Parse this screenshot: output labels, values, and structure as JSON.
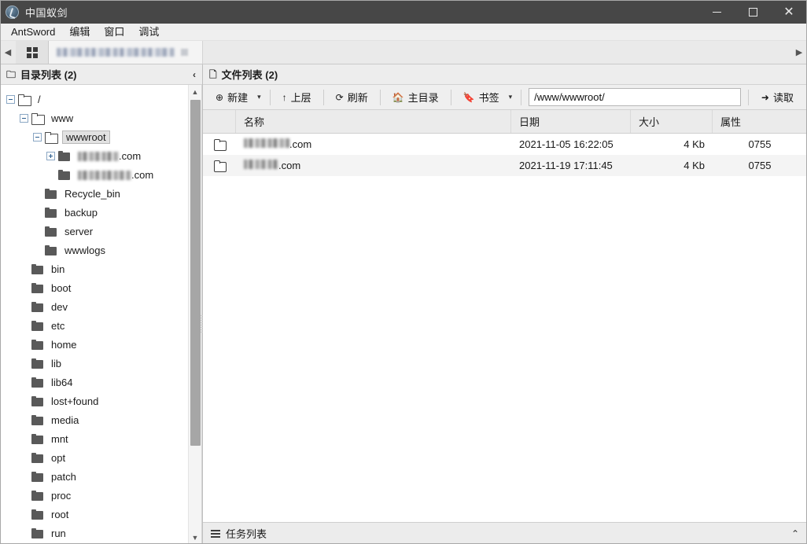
{
  "window": {
    "title": "中国蚁剑",
    "app_icon": "antsword-logo-icon",
    "minimize": "minimize-icon",
    "maximize": "maximize-icon",
    "close": "close-icon"
  },
  "menubar": {
    "items": [
      {
        "label": "AntSword"
      },
      {
        "label": "编辑"
      },
      {
        "label": "窗口"
      },
      {
        "label": "调试"
      }
    ]
  },
  "tabstrip": {
    "prev_arrow": "◀",
    "next_arrow": "▶",
    "grid_button": "grid-icon",
    "tab_label_redacted": ""
  },
  "left_panel": {
    "header": {
      "icon": "folder-outline-icon",
      "title": "目录列表 (2)",
      "collapse": "‹"
    },
    "tree": [
      {
        "label": "/",
        "depth": 0,
        "expander": "minus",
        "folder": "open",
        "selected": false,
        "blurred": false
      },
      {
        "label": "www",
        "depth": 1,
        "expander": "minus",
        "folder": "open",
        "selected": false,
        "blurred": false
      },
      {
        "label": "wwwroot",
        "depth": 2,
        "expander": "minus",
        "folder": "open",
        "selected": true,
        "blurred": false
      },
      {
        "label": ".com",
        "depth": 3,
        "expander": "plus",
        "folder": "closed",
        "selected": false,
        "blurred": true,
        "blur_width": 52
      },
      {
        "label": ".com",
        "depth": 3,
        "expander": "none",
        "folder": "closed",
        "selected": false,
        "blurred": true,
        "blur_width": 68
      },
      {
        "label": "Recycle_bin",
        "depth": 2,
        "expander": "none",
        "folder": "closed",
        "selected": false,
        "blurred": false
      },
      {
        "label": "backup",
        "depth": 2,
        "expander": "none",
        "folder": "closed",
        "selected": false,
        "blurred": false
      },
      {
        "label": "server",
        "depth": 2,
        "expander": "none",
        "folder": "closed",
        "selected": false,
        "blurred": false
      },
      {
        "label": "wwwlogs",
        "depth": 2,
        "expander": "none",
        "folder": "closed",
        "selected": false,
        "blurred": false
      },
      {
        "label": "bin",
        "depth": 1,
        "expander": "none",
        "folder": "closed",
        "selected": false,
        "blurred": false
      },
      {
        "label": "boot",
        "depth": 1,
        "expander": "none",
        "folder": "closed",
        "selected": false,
        "blurred": false
      },
      {
        "label": "dev",
        "depth": 1,
        "expander": "none",
        "folder": "closed",
        "selected": false,
        "blurred": false
      },
      {
        "label": "etc",
        "depth": 1,
        "expander": "none",
        "folder": "closed",
        "selected": false,
        "blurred": false
      },
      {
        "label": "home",
        "depth": 1,
        "expander": "none",
        "folder": "closed",
        "selected": false,
        "blurred": false
      },
      {
        "label": "lib",
        "depth": 1,
        "expander": "none",
        "folder": "closed",
        "selected": false,
        "blurred": false
      },
      {
        "label": "lib64",
        "depth": 1,
        "expander": "none",
        "folder": "closed",
        "selected": false,
        "blurred": false
      },
      {
        "label": "lost+found",
        "depth": 1,
        "expander": "none",
        "folder": "closed",
        "selected": false,
        "blurred": false
      },
      {
        "label": "media",
        "depth": 1,
        "expander": "none",
        "folder": "closed",
        "selected": false,
        "blurred": false
      },
      {
        "label": "mnt",
        "depth": 1,
        "expander": "none",
        "folder": "closed",
        "selected": false,
        "blurred": false
      },
      {
        "label": "opt",
        "depth": 1,
        "expander": "none",
        "folder": "closed",
        "selected": false,
        "blurred": false
      },
      {
        "label": "patch",
        "depth": 1,
        "expander": "none",
        "folder": "closed",
        "selected": false,
        "blurred": false
      },
      {
        "label": "proc",
        "depth": 1,
        "expander": "none",
        "folder": "closed",
        "selected": false,
        "blurred": false
      },
      {
        "label": "root",
        "depth": 1,
        "expander": "none",
        "folder": "closed",
        "selected": false,
        "blurred": false
      },
      {
        "label": "run",
        "depth": 1,
        "expander": "none",
        "folder": "closed",
        "selected": false,
        "blurred": false
      }
    ],
    "scrollbar": {
      "up": "▲",
      "down": "▼"
    }
  },
  "right_panel": {
    "header": {
      "icon": "file-outline-icon",
      "title": "文件列表 (2)"
    },
    "toolbar": {
      "new_label": "新建",
      "new_icon": "plus-circle-icon",
      "new_caret": "▾",
      "up_label": "上层",
      "up_icon": "arrow-up-icon",
      "refresh_label": "刷新",
      "refresh_icon": "refresh-icon",
      "home_label": "主目录",
      "home_icon": "home-icon",
      "bookmark_label": "书签",
      "bookmark_icon": "bookmark-icon",
      "bookmark_caret": "▾",
      "path_value": "/www/wwwroot/",
      "path_placeholder": "/www/wwwroot/",
      "read_label": "读取",
      "read_icon": "arrow-right-icon"
    },
    "table": {
      "columns": [
        "",
        "名称",
        "日期",
        "大小",
        "属性"
      ],
      "rows": [
        {
          "icon": "folder-icon",
          "name": ".com",
          "name_redacted": true,
          "name_blur_width": 58,
          "date": "2021-11-05 16:22:05",
          "size": "4 Kb",
          "attr": "0755"
        },
        {
          "icon": "folder-icon",
          "name": ".com",
          "name_redacted": true,
          "name_blur_width": 44,
          "date": "2021-11-19 17:11:45",
          "size": "4 Kb",
          "attr": "0755"
        }
      ]
    }
  },
  "statusbar": {
    "icon": "task-list-icon",
    "label": "任务列表",
    "expand": "⌃"
  },
  "colors": {
    "titlebar_bg": "#474747",
    "menubar_bg": "#efefef",
    "panel_head_bg": "#ededed",
    "toolbar_bg": "#efefef",
    "table_header_bg": "#ebebeb",
    "row_alt_bg": "#f4f4f4",
    "selection_bg": "#e2e2e2",
    "statusbar_bg": "#ececec"
  }
}
